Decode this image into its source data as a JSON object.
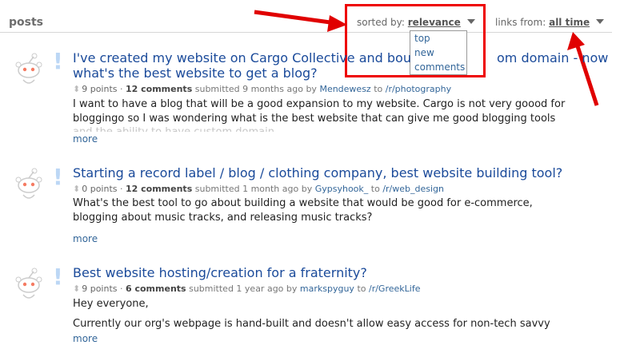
{
  "header": {
    "title": "posts",
    "sort_label": "sorted by:",
    "sort_value": "relevance",
    "links_label": "links from:",
    "links_value": "all time"
  },
  "sort_dropdown": {
    "options": [
      "top",
      "new",
      "comments"
    ]
  },
  "annotation_color": "#e00000",
  "posts": [
    {
      "title_line1": "I've created my website on Cargo Collective and bou",
      "title_line1_tail": "om domain - now",
      "title_line2": "what's the best website to get a blog?",
      "points": "9 points",
      "comments": "12 comments",
      "submitted": "submitted 9 months ago by",
      "author": "Mendewesz",
      "to": "to",
      "subreddit": "/r/photography",
      "body_line1": "I want to have a blog that will be a good expansion to my website. Cargo is not very goood for",
      "body_line2": "bloggingo so I was wondering what is the best website that can give me good blogging tools",
      "body_line3": "and the ability to have custom domain",
      "more": "more"
    },
    {
      "title_line1": "Starting a record label / blog / clothing company, best website building tool?",
      "points": "0 points",
      "comments": "12 comments",
      "submitted": "submitted 1 month ago by",
      "author": "Gypsyhook_",
      "to": "to",
      "subreddit": "/r/web_design",
      "body_line1": "What's the best tool to go about building a website that would be good for e-commerce,",
      "body_line2": "blogging about music tracks, and releasing music tracks?",
      "more": "more"
    },
    {
      "title_line1": "Best website hosting/creation for a fraternity?",
      "points": "9 points",
      "comments": "6 comments",
      "submitted": "submitted 1 year ago by",
      "author": "markspyguy",
      "to": "to",
      "subreddit": "/r/GreekLife",
      "body_line1": "Hey everyone,",
      "body_line2": "Currently our org's webpage is hand-built and doesn't allow easy access for non-tech savvy",
      "more": "more"
    }
  ]
}
